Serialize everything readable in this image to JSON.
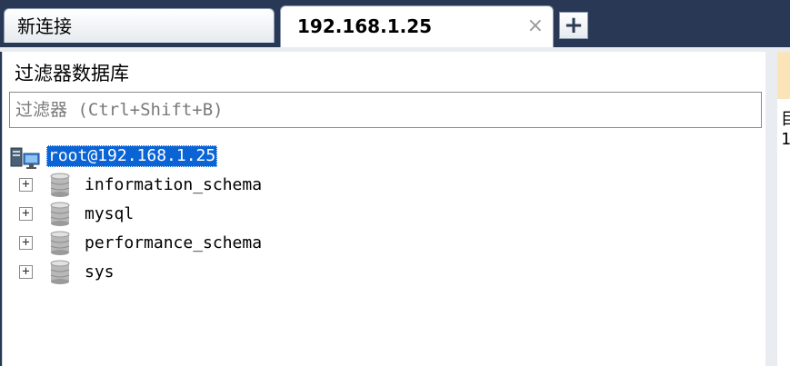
{
  "tabs": [
    {
      "label": "新连接",
      "active": false
    },
    {
      "label": "192.168.1.25",
      "active": true,
      "close_glyph": "×"
    }
  ],
  "add_tab_glyph": "+",
  "panel": {
    "title": "过滤器数据库",
    "filter_placeholder": "过滤器 (Ctrl+Shift+B)"
  },
  "tree": {
    "root": {
      "label": "root@192.168.1.25",
      "icon": "server-icon",
      "selected": true
    },
    "databases": [
      {
        "label": "information_schema",
        "icon": "database-icon",
        "expander": "+"
      },
      {
        "label": "mysql",
        "icon": "database-icon",
        "expander": "+"
      },
      {
        "label": "performance_schema",
        "icon": "database-icon",
        "expander": "+"
      },
      {
        "label": "sys",
        "icon": "database-icon",
        "expander": "+"
      }
    ]
  },
  "right_panel": {
    "lines": [
      "目",
      "1"
    ]
  },
  "colors": {
    "frame": "#293955",
    "selection": "#0a64d6",
    "right_header": "#fbe5b8"
  }
}
